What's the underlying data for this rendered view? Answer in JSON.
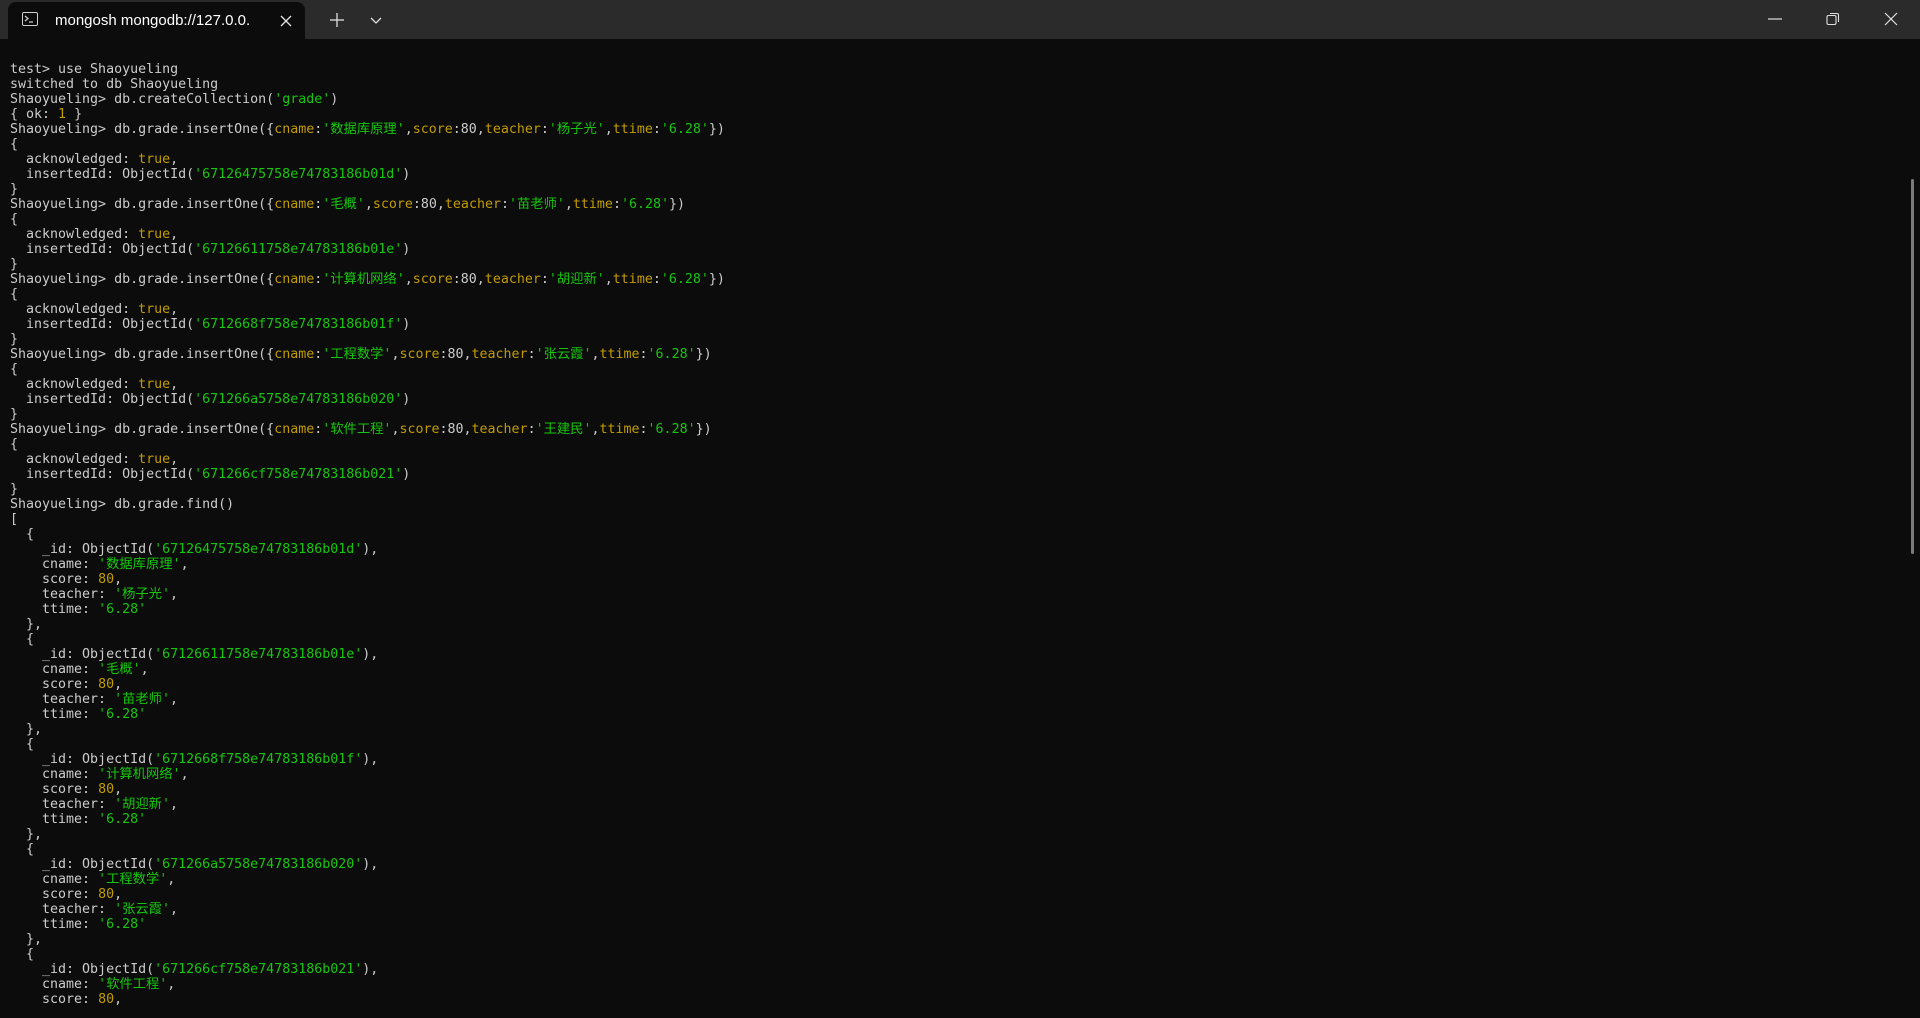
{
  "window": {
    "tab_title": "mongosh mongodb://127.0.0.",
    "icons": {
      "tab": "terminal-icon",
      "close": "close-icon",
      "new_tab": "plus-icon",
      "dropdown": "chevron-down-icon",
      "minimize": "minimize-icon",
      "restore": "restore-icon",
      "window_close": "close-icon"
    }
  },
  "colors": {
    "background": "#0c0c0c",
    "text": "#cccccc",
    "string": "#16c60c",
    "number": "#c19c00",
    "titlebar": "#2b2b2b"
  },
  "terminal": {
    "lines": [
      [
        {
          "t": "test> use Shaoyueling",
          "c": ""
        }
      ],
      [
        {
          "t": "switched to db Shaoyueling",
          "c": ""
        }
      ],
      [
        {
          "t": "Shaoyueling> db.createCollection(",
          "c": ""
        },
        {
          "t": "'grade'",
          "c": "s"
        },
        {
          "t": ")",
          "c": ""
        }
      ],
      [
        {
          "t": "{ ok: ",
          "c": ""
        },
        {
          "t": "1",
          "c": "n"
        },
        {
          "t": " }",
          "c": ""
        }
      ],
      [
        {
          "t": "Shaoyueling> db.grade.insertOne({",
          "c": ""
        },
        {
          "t": "cname",
          "c": "k"
        },
        {
          "t": ":",
          "c": ""
        },
        {
          "t": "'数据库原理'",
          "c": "s"
        },
        {
          "t": ",",
          "c": ""
        },
        {
          "t": "score",
          "c": "k"
        },
        {
          "t": ":80,",
          "c": ""
        },
        {
          "t": "teacher",
          "c": "k"
        },
        {
          "t": ":",
          "c": ""
        },
        {
          "t": "'杨子光'",
          "c": "s"
        },
        {
          "t": ",",
          "c": ""
        },
        {
          "t": "ttime",
          "c": "k"
        },
        {
          "t": ":",
          "c": ""
        },
        {
          "t": "'6.28'",
          "c": "s"
        },
        {
          "t": "})",
          "c": ""
        }
      ],
      [
        {
          "t": "{",
          "c": ""
        }
      ],
      [
        {
          "t": "  acknowledged: ",
          "c": ""
        },
        {
          "t": "true",
          "c": "n"
        },
        {
          "t": ",",
          "c": ""
        }
      ],
      [
        {
          "t": "  insertedId: ObjectId(",
          "c": ""
        },
        {
          "t": "'67126475758e74783186b01d'",
          "c": "s"
        },
        {
          "t": ")",
          "c": ""
        }
      ],
      [
        {
          "t": "}",
          "c": ""
        }
      ],
      [
        {
          "t": "Shaoyueling> db.grade.insertOne({",
          "c": ""
        },
        {
          "t": "cname",
          "c": "k"
        },
        {
          "t": ":",
          "c": ""
        },
        {
          "t": "'毛概'",
          "c": "s"
        },
        {
          "t": ",",
          "c": ""
        },
        {
          "t": "score",
          "c": "k"
        },
        {
          "t": ":80,",
          "c": ""
        },
        {
          "t": "teacher",
          "c": "k"
        },
        {
          "t": ":",
          "c": ""
        },
        {
          "t": "'苗老师'",
          "c": "s"
        },
        {
          "t": ",",
          "c": ""
        },
        {
          "t": "ttime",
          "c": "k"
        },
        {
          "t": ":",
          "c": ""
        },
        {
          "t": "'6.28'",
          "c": "s"
        },
        {
          "t": "})",
          "c": ""
        }
      ],
      [
        {
          "t": "{",
          "c": ""
        }
      ],
      [
        {
          "t": "  acknowledged: ",
          "c": ""
        },
        {
          "t": "true",
          "c": "n"
        },
        {
          "t": ",",
          "c": ""
        }
      ],
      [
        {
          "t": "  insertedId: ObjectId(",
          "c": ""
        },
        {
          "t": "'67126611758e74783186b01e'",
          "c": "s"
        },
        {
          "t": ")",
          "c": ""
        }
      ],
      [
        {
          "t": "}",
          "c": ""
        }
      ],
      [
        {
          "t": "Shaoyueling> db.grade.insertOne({",
          "c": ""
        },
        {
          "t": "cname",
          "c": "k"
        },
        {
          "t": ":",
          "c": ""
        },
        {
          "t": "'计算机网络'",
          "c": "s"
        },
        {
          "t": ",",
          "c": ""
        },
        {
          "t": "score",
          "c": "k"
        },
        {
          "t": ":80,",
          "c": ""
        },
        {
          "t": "teacher",
          "c": "k"
        },
        {
          "t": ":",
          "c": ""
        },
        {
          "t": "'胡迎新'",
          "c": "s"
        },
        {
          "t": ",",
          "c": ""
        },
        {
          "t": "ttime",
          "c": "k"
        },
        {
          "t": ":",
          "c": ""
        },
        {
          "t": "'6.28'",
          "c": "s"
        },
        {
          "t": "})",
          "c": ""
        }
      ],
      [
        {
          "t": "{",
          "c": ""
        }
      ],
      [
        {
          "t": "  acknowledged: ",
          "c": ""
        },
        {
          "t": "true",
          "c": "n"
        },
        {
          "t": ",",
          "c": ""
        }
      ],
      [
        {
          "t": "  insertedId: ObjectId(",
          "c": ""
        },
        {
          "t": "'6712668f758e74783186b01f'",
          "c": "s"
        },
        {
          "t": ")",
          "c": ""
        }
      ],
      [
        {
          "t": "}",
          "c": ""
        }
      ],
      [
        {
          "t": "Shaoyueling> db.grade.insertOne({",
          "c": ""
        },
        {
          "t": "cname",
          "c": "k"
        },
        {
          "t": ":",
          "c": ""
        },
        {
          "t": "'工程数学'",
          "c": "s"
        },
        {
          "t": ",",
          "c": ""
        },
        {
          "t": "score",
          "c": "k"
        },
        {
          "t": ":80,",
          "c": ""
        },
        {
          "t": "teacher",
          "c": "k"
        },
        {
          "t": ":",
          "c": ""
        },
        {
          "t": "'张云霞'",
          "c": "s"
        },
        {
          "t": ",",
          "c": ""
        },
        {
          "t": "ttime",
          "c": "k"
        },
        {
          "t": ":",
          "c": ""
        },
        {
          "t": "'6.28'",
          "c": "s"
        },
        {
          "t": "})",
          "c": ""
        }
      ],
      [
        {
          "t": "{",
          "c": ""
        }
      ],
      [
        {
          "t": "  acknowledged: ",
          "c": ""
        },
        {
          "t": "true",
          "c": "n"
        },
        {
          "t": ",",
          "c": ""
        }
      ],
      [
        {
          "t": "  insertedId: ObjectId(",
          "c": ""
        },
        {
          "t": "'671266a5758e74783186b020'",
          "c": "s"
        },
        {
          "t": ")",
          "c": ""
        }
      ],
      [
        {
          "t": "}",
          "c": ""
        }
      ],
      [
        {
          "t": "Shaoyueling> db.grade.insertOne({",
          "c": ""
        },
        {
          "t": "cname",
          "c": "k"
        },
        {
          "t": ":",
          "c": ""
        },
        {
          "t": "'软件工程'",
          "c": "s"
        },
        {
          "t": ",",
          "c": ""
        },
        {
          "t": "score",
          "c": "k"
        },
        {
          "t": ":80,",
          "c": ""
        },
        {
          "t": "teacher",
          "c": "k"
        },
        {
          "t": ":",
          "c": ""
        },
        {
          "t": "'王建民'",
          "c": "s"
        },
        {
          "t": ",",
          "c": ""
        },
        {
          "t": "ttime",
          "c": "k"
        },
        {
          "t": ":",
          "c": ""
        },
        {
          "t": "'6.28'",
          "c": "s"
        },
        {
          "t": "})",
          "c": ""
        }
      ],
      [
        {
          "t": "{",
          "c": ""
        }
      ],
      [
        {
          "t": "  acknowledged: ",
          "c": ""
        },
        {
          "t": "true",
          "c": "n"
        },
        {
          "t": ",",
          "c": ""
        }
      ],
      [
        {
          "t": "  insertedId: ObjectId(",
          "c": ""
        },
        {
          "t": "'671266cf758e74783186b021'",
          "c": "s"
        },
        {
          "t": ")",
          "c": ""
        }
      ],
      [
        {
          "t": "}",
          "c": ""
        }
      ],
      [
        {
          "t": "Shaoyueling> db.grade.find()",
          "c": ""
        }
      ],
      [
        {
          "t": "[",
          "c": ""
        }
      ],
      [
        {
          "t": "  {",
          "c": ""
        }
      ],
      [
        {
          "t": "    _id: ObjectId(",
          "c": ""
        },
        {
          "t": "'67126475758e74783186b01d'",
          "c": "s"
        },
        {
          "t": "),",
          "c": ""
        }
      ],
      [
        {
          "t": "    cname: ",
          "c": ""
        },
        {
          "t": "'数据库原理'",
          "c": "s"
        },
        {
          "t": ",",
          "c": ""
        }
      ],
      [
        {
          "t": "    score: ",
          "c": ""
        },
        {
          "t": "80",
          "c": "n"
        },
        {
          "t": ",",
          "c": ""
        }
      ],
      [
        {
          "t": "    teacher: ",
          "c": ""
        },
        {
          "t": "'杨子光'",
          "c": "s"
        },
        {
          "t": ",",
          "c": ""
        }
      ],
      [
        {
          "t": "    ttime: ",
          "c": ""
        },
        {
          "t": "'6.28'",
          "c": "s"
        }
      ],
      [
        {
          "t": "  },",
          "c": ""
        }
      ],
      [
        {
          "t": "  {",
          "c": ""
        }
      ],
      [
        {
          "t": "    _id: ObjectId(",
          "c": ""
        },
        {
          "t": "'67126611758e74783186b01e'",
          "c": "s"
        },
        {
          "t": "),",
          "c": ""
        }
      ],
      [
        {
          "t": "    cname: ",
          "c": ""
        },
        {
          "t": "'毛概'",
          "c": "s"
        },
        {
          "t": ",",
          "c": ""
        }
      ],
      [
        {
          "t": "    score: ",
          "c": ""
        },
        {
          "t": "80",
          "c": "n"
        },
        {
          "t": ",",
          "c": ""
        }
      ],
      [
        {
          "t": "    teacher: ",
          "c": ""
        },
        {
          "t": "'苗老师'",
          "c": "s"
        },
        {
          "t": ",",
          "c": ""
        }
      ],
      [
        {
          "t": "    ttime: ",
          "c": ""
        },
        {
          "t": "'6.28'",
          "c": "s"
        }
      ],
      [
        {
          "t": "  },",
          "c": ""
        }
      ],
      [
        {
          "t": "  {",
          "c": ""
        }
      ],
      [
        {
          "t": "    _id: ObjectId(",
          "c": ""
        },
        {
          "t": "'6712668f758e74783186b01f'",
          "c": "s"
        },
        {
          "t": "),",
          "c": ""
        }
      ],
      [
        {
          "t": "    cname: ",
          "c": ""
        },
        {
          "t": "'计算机网络'",
          "c": "s"
        },
        {
          "t": ",",
          "c": ""
        }
      ],
      [
        {
          "t": "    score: ",
          "c": ""
        },
        {
          "t": "80",
          "c": "n"
        },
        {
          "t": ",",
          "c": ""
        }
      ],
      [
        {
          "t": "    teacher: ",
          "c": ""
        },
        {
          "t": "'胡迎新'",
          "c": "s"
        },
        {
          "t": ",",
          "c": ""
        }
      ],
      [
        {
          "t": "    ttime: ",
          "c": ""
        },
        {
          "t": "'6.28'",
          "c": "s"
        }
      ],
      [
        {
          "t": "  },",
          "c": ""
        }
      ],
      [
        {
          "t": "  {",
          "c": ""
        }
      ],
      [
        {
          "t": "    _id: ObjectId(",
          "c": ""
        },
        {
          "t": "'671266a5758e74783186b020'",
          "c": "s"
        },
        {
          "t": "),",
          "c": ""
        }
      ],
      [
        {
          "t": "    cname: ",
          "c": ""
        },
        {
          "t": "'工程数学'",
          "c": "s"
        },
        {
          "t": ",",
          "c": ""
        }
      ],
      [
        {
          "t": "    score: ",
          "c": ""
        },
        {
          "t": "80",
          "c": "n"
        },
        {
          "t": ",",
          "c": ""
        }
      ],
      [
        {
          "t": "    teacher: ",
          "c": ""
        },
        {
          "t": "'张云霞'",
          "c": "s"
        },
        {
          "t": ",",
          "c": ""
        }
      ],
      [
        {
          "t": "    ttime: ",
          "c": ""
        },
        {
          "t": "'6.28'",
          "c": "s"
        }
      ],
      [
        {
          "t": "  },",
          "c": ""
        }
      ],
      [
        {
          "t": "  {",
          "c": ""
        }
      ],
      [
        {
          "t": "    _id: ObjectId(",
          "c": ""
        },
        {
          "t": "'671266cf758e74783186b021'",
          "c": "s"
        },
        {
          "t": "),",
          "c": ""
        }
      ],
      [
        {
          "t": "    cname: ",
          "c": ""
        },
        {
          "t": "'软件工程'",
          "c": "s"
        },
        {
          "t": ",",
          "c": ""
        }
      ],
      [
        {
          "t": "    score: ",
          "c": ""
        },
        {
          "t": "80",
          "c": "n"
        },
        {
          "t": ",",
          "c": ""
        }
      ]
    ]
  }
}
